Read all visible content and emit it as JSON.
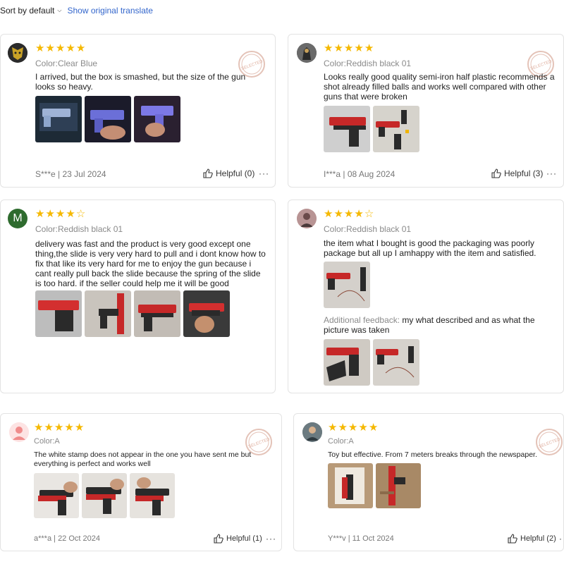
{
  "toolbar": {
    "sort_label": "Sort by default",
    "show_original": "Show original translate"
  },
  "reviews": [
    {
      "user": "S***e",
      "date": "23 Jul 2024",
      "stars": 5,
      "color": "Color:Clear Blue",
      "text": "I arrived, but the box is smashed, but the size of the gun looks so heavy.",
      "helpful": "Helpful (0)",
      "avatar_letter": ""
    },
    {
      "user": "I***a",
      "date": "08 Aug 2024",
      "stars": 5,
      "color": "Color:Reddish black 01",
      "text": "Looks really good quality semi-iron half plastic recommends a shot already filled balls and works well compared with other guns that were broken",
      "helpful": "Helpful (3)",
      "avatar_letter": ""
    },
    {
      "user": "",
      "date": "",
      "stars": 4,
      "color": "Color:Reddish black 01",
      "text": "delivery was fast and the product is very good except one thing,the slide is very very hard to pull and i dont know how to fix that like its very hard for me to enjoy the gun because i cant really pull back the slide because the spring of the slide is too hard. if the seller could help me it will be good",
      "helpful": "",
      "avatar_letter": "M"
    },
    {
      "user": "",
      "date": "",
      "stars": 4,
      "color": "Color:Reddish black 01",
      "text": "the item what I bought is good the packaging was poorly package but all up I amhappy with the item and satisfied.",
      "additional_label": "Additional feedback:",
      "additional_text": "my what described and as what the picture was taken",
      "helpful": "",
      "avatar_letter": ""
    },
    {
      "user": "a***a",
      "date": "22 Oct 2024",
      "stars": 5,
      "color": "Color:A",
      "text": "The white stamp does not appear in the one you have sent me but everything is perfect and works well",
      "helpful": "Helpful (1)",
      "avatar_letter": ""
    },
    {
      "user": "Y***v",
      "date": "11 Oct 2024",
      "stars": 5,
      "color": "Color:A",
      "text": "Toy but effective. From 7 meters breaks through the newspaper.",
      "helpful": "Helpful (2)",
      "avatar_letter": ""
    }
  ],
  "separator": "|",
  "more_glyph": "···",
  "star_glyph_full": "★",
  "star_glyph_empty": "☆",
  "stamp_text": "SELECTED",
  "colors": {
    "link": "#3366cc",
    "star": "#f5b800",
    "avatar_m": "#2e6b2e"
  },
  "icons": [
    "chevron-down-icon",
    "thumbs-up-icon",
    "more-icon",
    "selected-stamp-icon"
  ]
}
